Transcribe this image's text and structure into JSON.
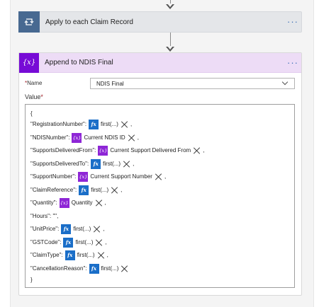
{
  "loop_step": {
    "title": "Apply to each Claim Record",
    "more": "···",
    "icon": "loop-icon"
  },
  "append_step": {
    "title": "Append to NDIS Final",
    "more": "···",
    "icon_text": "{x}",
    "name_label": "Name",
    "name_value": "NDIS Final",
    "value_label": "Value",
    "required_mark": "*"
  },
  "value_editor": {
    "open": "{",
    "close": "}",
    "lines": [
      {
        "key": "\"RegistrationNumber\":",
        "token_type": "fx",
        "token_text": "first(...)",
        "after": ","
      },
      {
        "key": "\"NDISNumber\":",
        "token_type": "var",
        "token_text": "Current NDIS ID",
        "after": ","
      },
      {
        "key": "\"SupportsDeliveredFrom\":",
        "token_type": "var",
        "token_text": "Current Support Delivered From",
        "after": ","
      },
      {
        "key": "\"SupportsDeliveredTo\":",
        "token_type": "fx",
        "token_text": "first(...)",
        "after": ","
      },
      {
        "key": "\"SupportNumber\":",
        "token_type": "var",
        "token_text": "Current Support Number",
        "after": ","
      },
      {
        "key": "\"ClaimReference\":",
        "token_type": "fx",
        "token_text": "first(...)",
        "after": ","
      },
      {
        "key": "\"Quantity\":",
        "token_type": "var",
        "token_text": "Quantity",
        "after": ","
      },
      {
        "key": "\"Hours\": \"\",",
        "token_type": "none",
        "token_text": "",
        "after": ""
      },
      {
        "key": "\"UnitPrice\":",
        "token_type": "fx",
        "token_text": "first(...)",
        "after": ","
      },
      {
        "key": "\"GSTCode\":",
        "token_type": "fx",
        "token_text": "first(...)",
        "after": ","
      },
      {
        "key": "\"ClaimType\":",
        "token_type": "fx",
        "token_text": "first(...)",
        "after": ","
      },
      {
        "key": "\"CancellationReason\":",
        "token_type": "fx",
        "token_text": "first(...)",
        "after": ""
      }
    ]
  },
  "token_icons": {
    "fx": "fx",
    "var": "{x}"
  },
  "colors": {
    "loop_icon_bg": "#486991",
    "variable_purple": "#770bd6",
    "expression_blue": "#1a6ec8",
    "append_header_bg": "#eddcf6"
  }
}
